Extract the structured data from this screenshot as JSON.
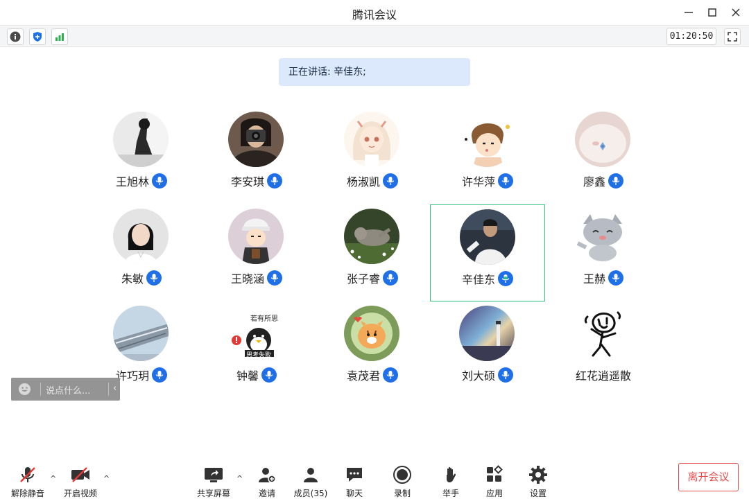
{
  "window": {
    "title": "腾讯会议"
  },
  "infobar": {
    "timer": "01:20:50"
  },
  "speaking_banner": "正在讲话: 辛佳东;",
  "participants": [
    {
      "name": "王旭林",
      "avatar": "avatar-photo-bw",
      "mic": "on"
    },
    {
      "name": "李安琪",
      "avatar": "avatar-photo-camera",
      "mic": "on"
    },
    {
      "name": "杨淑凯",
      "avatar": "avatar-anime-girl",
      "mic": "on"
    },
    {
      "name": "许华萍",
      "avatar": "avatar-cartoon-boy",
      "mic": "on"
    },
    {
      "name": "廖鑫",
      "avatar": "avatar-pink-cat",
      "mic": "on"
    },
    {
      "name": "朱敏",
      "avatar": "avatar-photo-woman",
      "mic": "on"
    },
    {
      "name": "王晓涵",
      "avatar": "avatar-cartoon-cap-boy",
      "mic": "on"
    },
    {
      "name": "张子睿",
      "avatar": "avatar-cat-grass",
      "mic": "on"
    },
    {
      "name": "辛佳东",
      "avatar": "avatar-football-player",
      "mic": "speaking",
      "active": true
    },
    {
      "name": "王赫",
      "avatar": "avatar-cartoon-cat",
      "mic": "on"
    },
    {
      "name": "许巧玥",
      "avatar": "avatar-building-sky",
      "mic": "on"
    },
    {
      "name": "钟馨",
      "avatar": "avatar-penguin-sticker",
      "mic": "on",
      "sticker_text_top": "若有所思",
      "sticker_text_bottom": "思考失败"
    },
    {
      "name": "袁茂君",
      "avatar": "avatar-tiger-cartoon",
      "mic": "on"
    },
    {
      "name": "刘大硕",
      "avatar": "avatar-lighthouse",
      "mic": "on"
    },
    {
      "name": "红花逍遥散",
      "avatar": "avatar-doodle-sketch",
      "mic": "none"
    }
  ],
  "chat": {
    "placeholder": "说点什么..."
  },
  "toolbar": {
    "unmute": "解除静音",
    "start_video": "开启视频",
    "share_screen": "共享屏幕",
    "invite": "邀请",
    "members": "成员(35)",
    "chat": "聊天",
    "record": "录制",
    "raise_hand": "举手",
    "apps": "应用",
    "settings": "设置",
    "leave": "离开会议"
  },
  "colors": {
    "mic_badge": "#1e6fe8",
    "speaking_green": "#2ec47f",
    "leave_red": "#e34b4b",
    "banner_bg": "#dce9fc"
  }
}
